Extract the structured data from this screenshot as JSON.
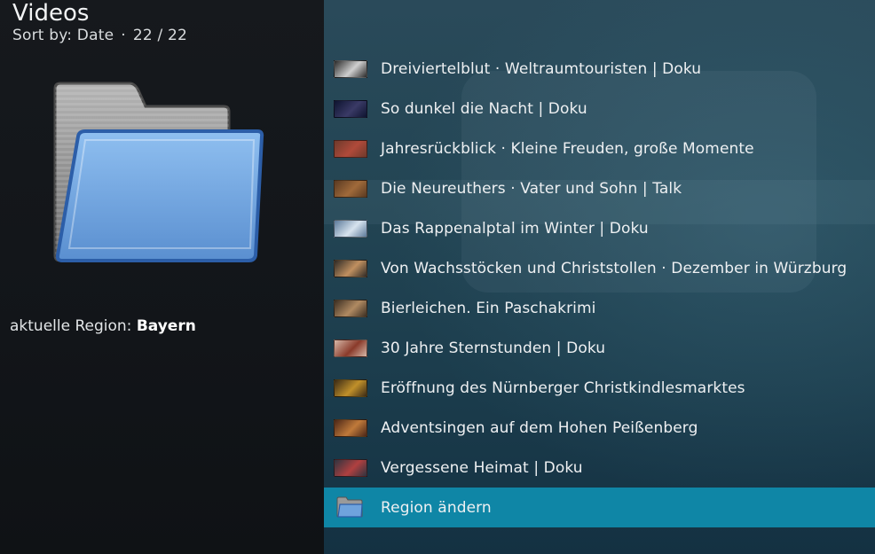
{
  "header": {
    "title": "Videos",
    "sort_label": "Sort by: Date",
    "separator": "·",
    "count": "22 / 22"
  },
  "info": {
    "region_prefix": "aktuelle Region:",
    "region_value": "Bayern"
  },
  "list": {
    "items": [
      {
        "label": "Dreiviertelblut · Weltraumtouristen | Doku",
        "thumb": [
          "#2a2a2a",
          "#cfcfcf"
        ]
      },
      {
        "label": "So dunkel die Nacht | Doku",
        "thumb": [
          "#0e1430",
          "#3a3a66"
        ]
      },
      {
        "label": "Jahresrückblick · Kleine Freuden, große Momente",
        "thumb": [
          "#6e3a2c",
          "#b04a3a"
        ]
      },
      {
        "label": "Die Neureuthers · Vater und Sohn | Talk",
        "thumb": [
          "#5a3a22",
          "#a06a3a"
        ]
      },
      {
        "label": "Das Rappenalptal im Winter | Doku",
        "thumb": [
          "#5c7a9a",
          "#d7e3ee"
        ]
      },
      {
        "label": "Von Wachsstöcken und Christstollen · Dezember in Würzburg",
        "thumb": [
          "#2e2a26",
          "#c09060"
        ]
      },
      {
        "label": "Bierleichen. Ein Paschakrimi",
        "thumb": [
          "#3a2e22",
          "#b08a62"
        ]
      },
      {
        "label": "30 Jahre Sternstunden | Doku",
        "thumb": [
          "#d6b8a8",
          "#8a3a2a"
        ]
      },
      {
        "label": "Eröffnung des Nürnberger Christkindlesmarktes",
        "thumb": [
          "#3a2a16",
          "#c0902a"
        ]
      },
      {
        "label": "Adventsingen auf dem Hohen Peißenberg",
        "thumb": [
          "#4a2618",
          "#c07a3a"
        ]
      },
      {
        "label": "Vergessene Heimat | Doku",
        "thumb": [
          "#2e3440",
          "#b04040"
        ]
      },
      {
        "label": "Region ändern",
        "folder": true,
        "selected": true
      }
    ]
  },
  "colors": {
    "selected_row": "#0f86a6",
    "folder_front": "#6fa3dd",
    "folder_back": "#9a9a9a"
  }
}
